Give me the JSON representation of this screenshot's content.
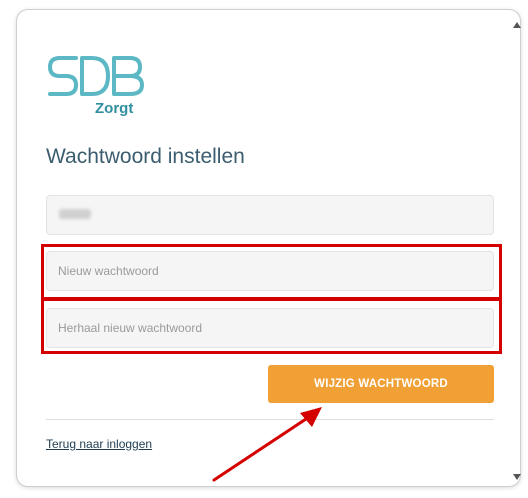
{
  "brand": {
    "logo_text": "SDB",
    "logo_sub": "Zorgt",
    "logo_color": "#5bb8c4",
    "logo_sub_color": "#2f8fa0"
  },
  "form": {
    "title": "Wachtwoord instellen",
    "username_placeholder": "",
    "new_password_placeholder": "Nieuw wachtwoord",
    "repeat_password_placeholder": "Herhaal nieuw wachtwoord",
    "submit_label": "WIJZIG WACHTWOORD",
    "back_link": "Terug naar inloggen"
  },
  "colors": {
    "accent": "#f0a035",
    "highlight": "#d40000",
    "title": "#3b5d6f"
  }
}
